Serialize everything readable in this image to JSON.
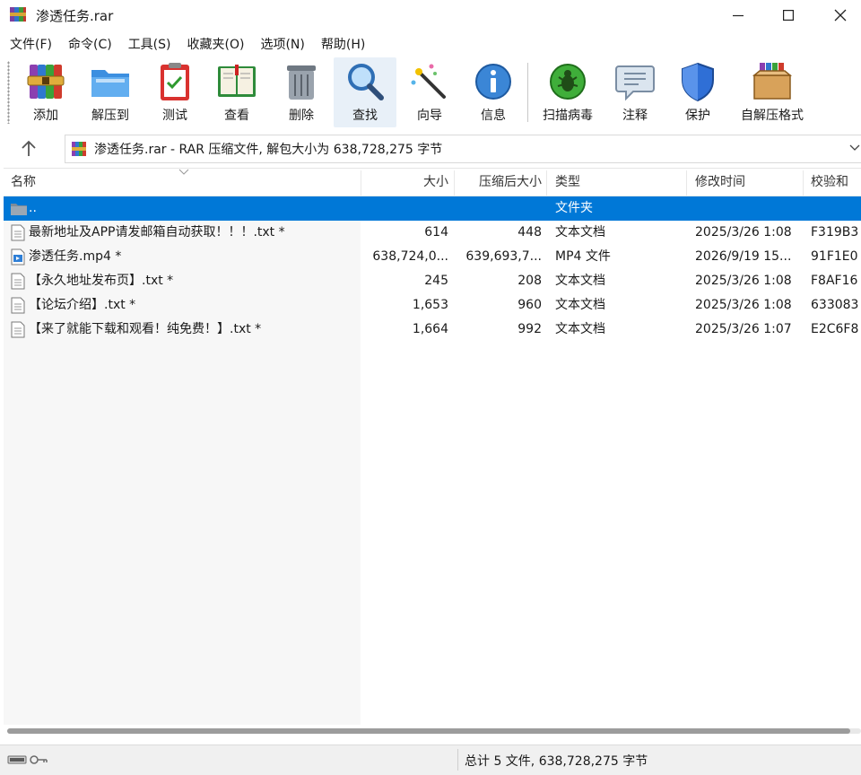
{
  "window": {
    "title": "渗透任务.rar"
  },
  "menu": [
    "文件(F)",
    "命令(C)",
    "工具(S)",
    "收藏夹(O)",
    "选项(N)",
    "帮助(H)"
  ],
  "toolbar": [
    {
      "label": "添加",
      "icon": "add-archive-icon"
    },
    {
      "label": "解压到",
      "icon": "extract-folder-icon"
    },
    {
      "label": "测试",
      "icon": "test-clipboard-icon"
    },
    {
      "label": "查看",
      "icon": "view-book-icon"
    },
    {
      "label": "删除",
      "icon": "trash-can-icon"
    },
    {
      "label": "查找",
      "icon": "magnifier-icon"
    },
    {
      "label": "向导",
      "icon": "magic-wand-icon"
    },
    {
      "label": "信息",
      "icon": "info-icon"
    },
    {
      "label": "扫描病毒",
      "icon": "virus-scan-icon"
    },
    {
      "label": "注释",
      "icon": "comment-icon"
    },
    {
      "label": "保护",
      "icon": "shield-icon"
    },
    {
      "label": "自解压格式",
      "icon": "sfx-box-icon"
    }
  ],
  "address": {
    "path": "渗透任务.rar - RAR 压缩文件, 解包大小为 638,728,275 字节"
  },
  "columns": {
    "name": "名称",
    "size": "大小",
    "packed": "压缩后大小",
    "type": "类型",
    "modified": "修改时间",
    "crc": "校验和"
  },
  "rows": [
    {
      "name": "..",
      "size": "",
      "packed": "",
      "type": "文件夹",
      "modified": "",
      "crc": "",
      "icon": "folder-icon",
      "selected": true
    },
    {
      "name": "最新地址及APP请发邮箱自动获取！！！.txt *",
      "size": "614",
      "packed": "448",
      "type": "文本文档",
      "modified": "2025/3/26 1:08",
      "crc": "F319B3",
      "icon": "text-file-icon"
    },
    {
      "name": "渗透任务.mp4 *",
      "size": "638,724,0...",
      "packed": "639,693,7...",
      "type": "MP4 文件",
      "modified": "2026/9/19 15...",
      "crc": "91F1E0",
      "icon": "video-file-icon"
    },
    {
      "name": "【永久地址发布页】.txt *",
      "size": "245",
      "packed": "208",
      "type": "文本文档",
      "modified": "2025/3/26 1:08",
      "crc": "F8AF16",
      "icon": "text-file-icon"
    },
    {
      "name": "【论坛介绍】.txt *",
      "size": "1,653",
      "packed": "960",
      "type": "文本文档",
      "modified": "2025/3/26 1:08",
      "crc": "633083",
      "icon": "text-file-icon"
    },
    {
      "name": "【来了就能下载和观看！纯免费！】.txt *",
      "size": "1,664",
      "packed": "992",
      "type": "文本文档",
      "modified": "2025/3/26 1:07",
      "crc": "E2C6F8",
      "icon": "text-file-icon"
    }
  ],
  "status": {
    "summary": "总计 5 文件, 638,728,275 字节"
  },
  "colors": {
    "selection": "#0078d7",
    "name_column_bg": "#f7f7f7"
  }
}
